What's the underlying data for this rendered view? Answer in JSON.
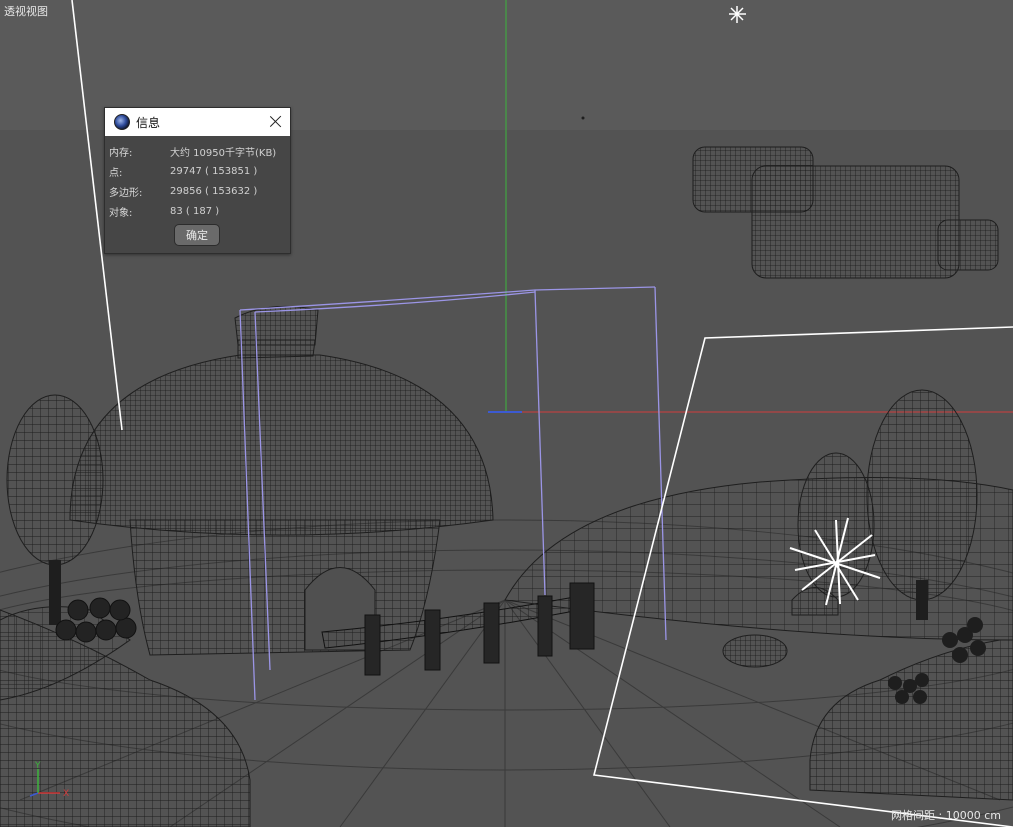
{
  "viewport": {
    "label": "透视视图",
    "grid_spacing": "网格间距 : 10000 cm",
    "colors": {
      "background": "#555555",
      "wireframe": "#1e1e1e",
      "selection": "#9b95e6",
      "camera_frame": "#ffffff",
      "x_axis": "#d23c3c",
      "y_axis": "#3cb43c",
      "z_axis": "#3c5ad2"
    },
    "axis_gizmo": {
      "x": "X",
      "y": "Y"
    }
  },
  "dialog": {
    "title": "信息",
    "icon": "cinema4d-logo-icon",
    "rows": [
      {
        "label": "内存:",
        "value": "大约 10950千字节(KB)"
      },
      {
        "label": "点:",
        "value": "29747 ( 153851 )"
      },
      {
        "label": "多边形:",
        "value": "29856 ( 153632 )"
      },
      {
        "label": "对象:",
        "value": "83 ( 187 )"
      }
    ],
    "ok_label": "确定"
  }
}
